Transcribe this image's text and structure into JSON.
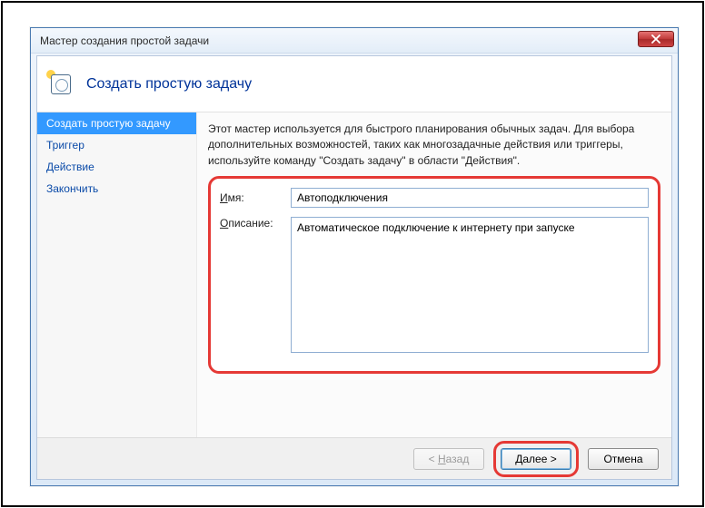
{
  "window": {
    "title": "Мастер создания простой задачи"
  },
  "header": {
    "title": "Создать простую задачу"
  },
  "sidebar": {
    "items": [
      {
        "label": "Создать простую задачу",
        "active": true
      },
      {
        "label": "Триггер",
        "active": false
      },
      {
        "label": "Действие",
        "active": false
      },
      {
        "label": "Закончить",
        "active": false
      }
    ]
  },
  "content": {
    "intro": "Этот мастер используется для быстрого планирования обычных задач.  Для выбора дополнительных возможностей, таких как многозадачные действия или триггеры, используйте команду \"Создать задачу\" в области \"Действия\".",
    "name_label": "Имя:",
    "name_value": "Автоподключения",
    "name_underline": "И",
    "desc_label": "Описание:",
    "desc_value": "Автоматическое подключение к интернету при запуске",
    "desc_underline": "О"
  },
  "footer": {
    "back": "< Назад",
    "back_underline": "Н",
    "next": "Далее >",
    "next_underline": "Д",
    "cancel": "Отмена"
  }
}
